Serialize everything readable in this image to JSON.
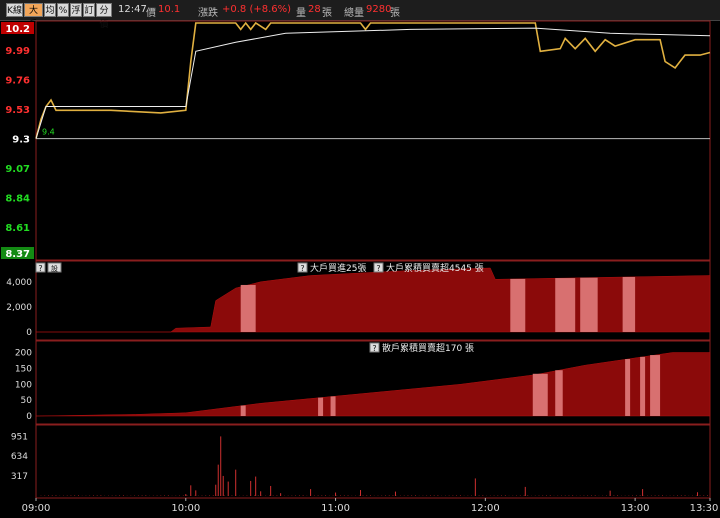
{
  "toolbar": {
    "buttons": [
      "K線",
      "大戶",
      "均",
      "%",
      "浮",
      "訂",
      "分價"
    ],
    "time": "12:47",
    "price_label": "價",
    "price_value": "10.1",
    "change_label": "漲跌",
    "change_value": "+0.8 (+8.6%)",
    "volume_label": "量",
    "volume_value": "28",
    "volume_unit": "張",
    "total_label": "總量",
    "total_value": "9280",
    "total_unit": "張"
  },
  "price_panel": {
    "price_ticks": [
      "10.2",
      "9.99",
      "9.76",
      "9.53",
      "9.3",
      "9.07",
      "8.84",
      "8.61",
      "8.37"
    ],
    "open_marker": "9.4",
    "colors": {
      "up": "#ff3030",
      "ref": "#ffffff",
      "down": "#22dd22",
      "price_line": "#e0b040",
      "avg_line": "#eeeeee"
    }
  },
  "big_panel": {
    "help_icon": "?",
    "toggle_button": "設",
    "legend_speed": "大戶買進25張",
    "legend_cum": "大戶累積買賣超4545 張",
    "y_ticks": [
      "4,000",
      "2,000",
      "0"
    ]
  },
  "retail_panel": {
    "legend": "散戶累積買賣超170 張",
    "y_ticks": [
      "200",
      "150",
      "100",
      "50",
      "0"
    ]
  },
  "volume_panel": {
    "y_ticks": [
      "951",
      "634",
      "317"
    ]
  },
  "time_axis": [
    "09:00",
    "10:00",
    "11:00",
    "12:00",
    "13:00",
    "13:30"
  ],
  "chart_data": {
    "type": "line",
    "x_unit": "minutes since 09:00",
    "price": {
      "ylim": [
        8.37,
        10.2
      ],
      "series": [
        {
          "name": "price",
          "points": [
            [
              0,
              9.3
            ],
            [
              2,
              9.45
            ],
            [
              4,
              9.55
            ],
            [
              6,
              9.6
            ],
            [
              8,
              9.52
            ],
            [
              30,
              9.52
            ],
            [
              50,
              9.5
            ],
            [
              60,
              9.52
            ],
            [
              62,
              9.9
            ],
            [
              64,
              10.2
            ],
            [
              80,
              10.2
            ],
            [
              82,
              10.15
            ],
            [
              84,
              10.2
            ],
            [
              86,
              10.15
            ],
            [
              88,
              10.2
            ],
            [
              92,
              10.15
            ],
            [
              94,
              10.2
            ],
            [
              130,
              10.2
            ],
            [
              132,
              10.15
            ],
            [
              134,
              10.2
            ],
            [
              200,
              10.2
            ],
            [
              202,
              9.98
            ],
            [
              210,
              10.0
            ],
            [
              212,
              10.08
            ],
            [
              216,
              10.0
            ],
            [
              220,
              10.08
            ],
            [
              224,
              9.98
            ],
            [
              228,
              10.07
            ],
            [
              232,
              10.02
            ],
            [
              240,
              10.07
            ],
            [
              250,
              10.07
            ],
            [
              252,
              9.9
            ],
            [
              256,
              9.85
            ],
            [
              258,
              9.9
            ],
            [
              260,
              9.95
            ],
            [
              266,
              9.95
            ],
            [
              270,
              9.97
            ]
          ]
        },
        {
          "name": "average",
          "points": [
            [
              0,
              9.3
            ],
            [
              4,
              9.55
            ],
            [
              60,
              9.55
            ],
            [
              64,
              9.98
            ],
            [
              80,
              10.05
            ],
            [
              100,
              10.12
            ],
            [
              150,
              10.15
            ],
            [
              200,
              10.16
            ],
            [
              230,
              10.12
            ],
            [
              270,
              10.1
            ]
          ]
        }
      ]
    },
    "big_trader": {
      "ylim": [
        0,
        5500
      ],
      "points": [
        [
          0,
          0
        ],
        [
          54,
          0
        ],
        [
          56,
          300
        ],
        [
          70,
          400
        ],
        [
          72,
          2500
        ],
        [
          80,
          3500
        ],
        [
          90,
          4000
        ],
        [
          110,
          4500
        ],
        [
          150,
          4900
        ],
        [
          182,
          5100
        ],
        [
          184,
          4200
        ],
        [
          270,
          4500
        ]
      ],
      "highlights": [
        [
          82,
          88
        ],
        [
          190,
          196
        ],
        [
          208,
          216
        ],
        [
          218,
          225
        ],
        [
          235,
          240
        ]
      ]
    },
    "retail": {
      "ylim": [
        0,
        230
      ],
      "points": [
        [
          0,
          0
        ],
        [
          40,
          5
        ],
        [
          60,
          10
        ],
        [
          90,
          40
        ],
        [
          130,
          70
        ],
        [
          170,
          100
        ],
        [
          200,
          130
        ],
        [
          220,
          160
        ],
        [
          255,
          200
        ],
        [
          270,
          200
        ]
      ],
      "highlights": [
        [
          82,
          84
        ],
        [
          113,
          115
        ],
        [
          118,
          120
        ],
        [
          199,
          205
        ],
        [
          208,
          211
        ],
        [
          236,
          238
        ],
        [
          242,
          244
        ],
        [
          246,
          250
        ]
      ]
    },
    "volume": {
      "ylim": [
        0,
        1100
      ],
      "points": [
        [
          60,
          30
        ],
        [
          62,
          170
        ],
        [
          64,
          90
        ],
        [
          72,
          180
        ],
        [
          73,
          500
        ],
        [
          74,
          950
        ],
        [
          75,
          320
        ],
        [
          77,
          230
        ],
        [
          80,
          420
        ],
        [
          86,
          240
        ],
        [
          88,
          310
        ],
        [
          90,
          75
        ],
        [
          94,
          160
        ],
        [
          98,
          45
        ],
        [
          110,
          110
        ],
        [
          120,
          55
        ],
        [
          130,
          95
        ],
        [
          144,
          70
        ],
        [
          176,
          280
        ],
        [
          196,
          145
        ],
        [
          230,
          85
        ],
        [
          243,
          110
        ],
        [
          265,
          60
        ]
      ]
    }
  }
}
